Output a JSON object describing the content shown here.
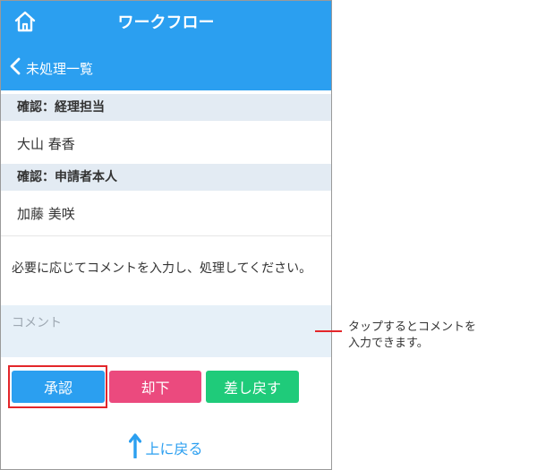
{
  "header": {
    "title": "ワークフロー",
    "back_label": "未処理一覧"
  },
  "approvers": [
    {
      "heading": "確認：経理担当",
      "name": "大山 春香"
    },
    {
      "heading": "確認：申請者本人",
      "name": "加藤 美咲"
    }
  ],
  "comment": {
    "instruction": "必要に応じてコメントを入力し、処理してください。",
    "placeholder": "コメント",
    "value": ""
  },
  "actions": {
    "approve_label": "承認",
    "reject_label": "却下",
    "return_label": "差し戻す"
  },
  "footer": {
    "to_top_label": "上に戻る"
  },
  "annotation": {
    "line1": "タップするとコメントを",
    "line2": "入力できます。"
  },
  "colors": {
    "header_bg": "#2b9ff0",
    "approve": "#2b9ff0",
    "reject": "#eb4a7e",
    "return": "#1fcb7a",
    "highlight": "#e3262a"
  },
  "icons": {
    "home": "home-icon",
    "back": "chevron-left-icon",
    "to_top": "arrow-up-icon"
  }
}
